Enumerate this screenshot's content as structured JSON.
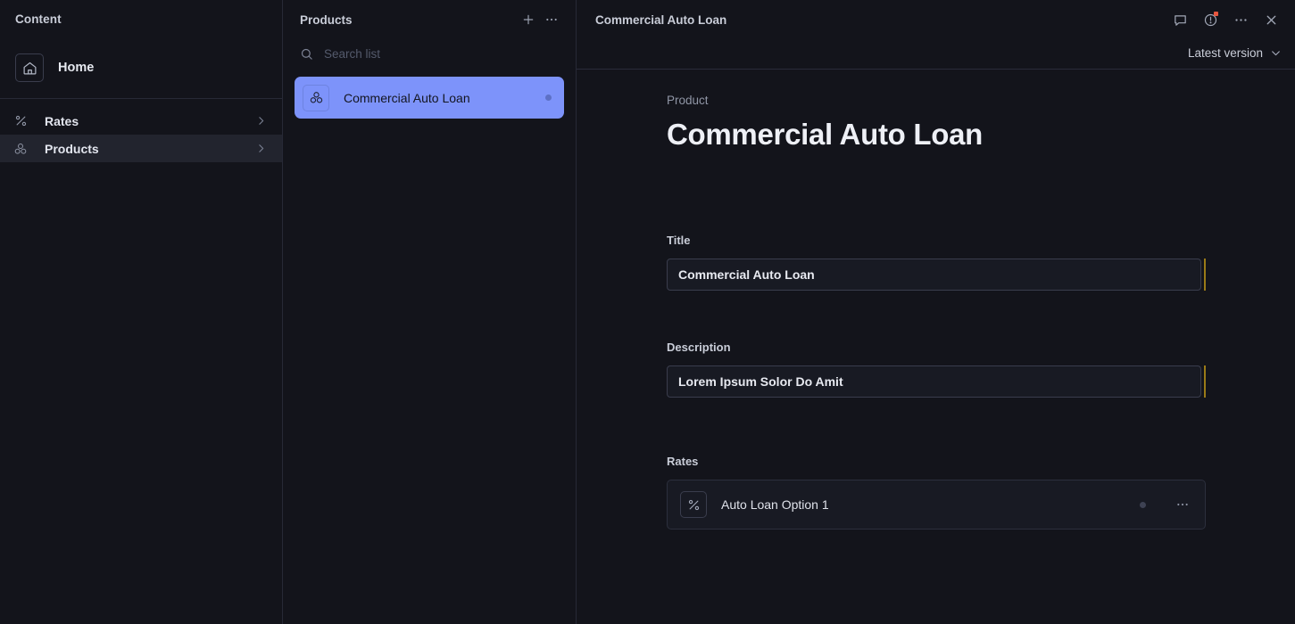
{
  "sidebar": {
    "title": "Content",
    "home": {
      "label": "Home",
      "icon": "home-icon"
    },
    "items": [
      {
        "label": "Rates",
        "icon": "percent-icon",
        "active": false
      },
      {
        "label": "Products",
        "icon": "cubes-icon",
        "active": true
      }
    ]
  },
  "list_panel": {
    "title": "Products",
    "add_icon": "plus-icon",
    "more_icon": "ellipsis-icon",
    "search": {
      "placeholder": "Search list",
      "value": "",
      "icon": "search-icon"
    },
    "items": [
      {
        "label": "Commercial Auto Loan",
        "icon": "cubes-icon",
        "selected": true,
        "status_dot": true
      }
    ]
  },
  "detail": {
    "header_title": "Commercial Auto Loan",
    "actions": [
      {
        "name": "comment-icon",
        "label": "Comments"
      },
      {
        "name": "history-icon",
        "label": "History",
        "badge": true
      },
      {
        "name": "ellipsis-icon",
        "label": "More"
      },
      {
        "name": "close-icon",
        "label": "Close"
      }
    ],
    "version_label": "Latest version",
    "version_chevron": "chevron-down-icon",
    "document": {
      "kicker": "Product",
      "title": "Commercial Auto Loan"
    },
    "fields": {
      "title": {
        "label": "Title",
        "value": "Commercial Auto Loan",
        "dirty": true
      },
      "description": {
        "label": "Description",
        "value": "Lorem Ipsum Solor Do Amit",
        "dirty": true
      },
      "rates": {
        "label": "Rates",
        "rows": [
          {
            "label": "Auto Loan Option 1",
            "icon": "percent-icon",
            "status_dot": true,
            "menu_icon": "ellipsis-icon"
          }
        ]
      }
    }
  },
  "colors": {
    "background": "#13141b",
    "panel_border": "#272936",
    "accent_selected": "#7d93fa",
    "dirty_indicator": "#9a7a17",
    "notification": "#e8563f",
    "active_nav": "#22242e"
  }
}
